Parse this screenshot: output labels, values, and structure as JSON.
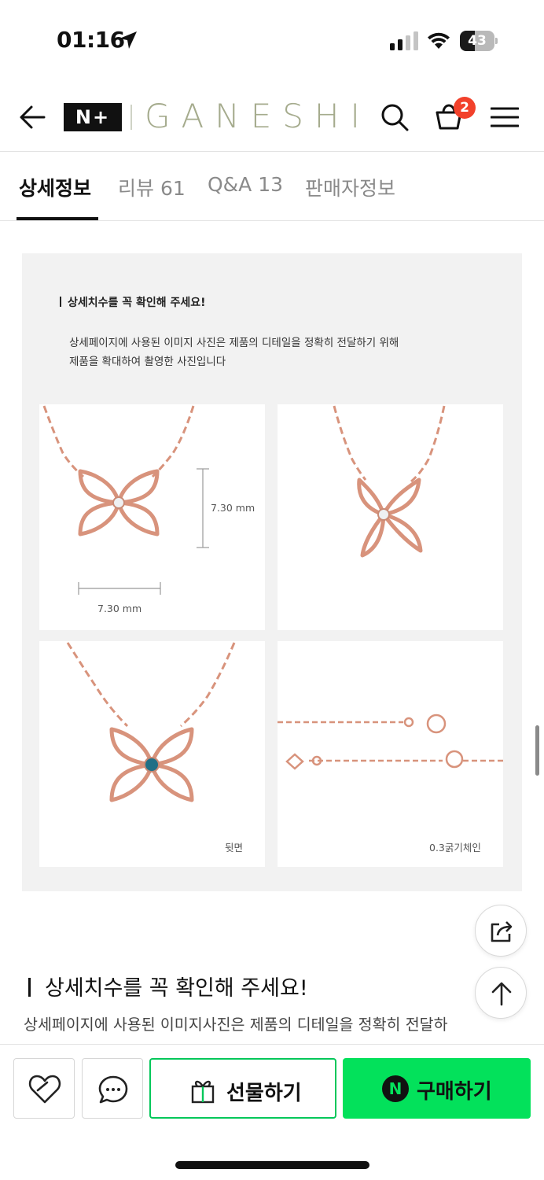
{
  "status_bar": {
    "time": "01:16",
    "battery": "43",
    "battery_level": 0.43
  },
  "header": {
    "logo_badge": "N+",
    "brand": "GANESHI",
    "cart_count": "2"
  },
  "tabs": [
    {
      "label": "상세정보"
    },
    {
      "label": "리뷰 61"
    },
    {
      "label": "Q&A 13"
    },
    {
      "label": "판매자정보"
    }
  ],
  "detail": {
    "notice_title": "상세치수를 꼭 확인해 주세요!",
    "notice_line1": "상세페이지에 사용된 이미지 사진은 제품의 디테일을 정확히 전달하기 위해",
    "notice_line2": "제품을 확대하여 촬영한 사진입니다",
    "dim_vertical": "7.30 mm",
    "dim_horizontal": "7.30 mm",
    "caption_back": "뒷면",
    "caption_chain": "0.3굵기체인"
  },
  "section": {
    "title": "상세치수를 꼭 확인해 주세요!",
    "desc": "상세페이지에 사용된 이미지사진은 제품의 디테일을 정확히 전달하"
  },
  "bottom_bar": {
    "gift_label": "선물하기",
    "buy_label": "구매하기",
    "buy_icon_letter": "N"
  },
  "colors": {
    "accent_green": "#03c75a",
    "buy_green": "#03e15b",
    "badge_red": "#f2412b",
    "rose_gold": "#d8937c",
    "brand_olive": "#a5ab8d"
  }
}
